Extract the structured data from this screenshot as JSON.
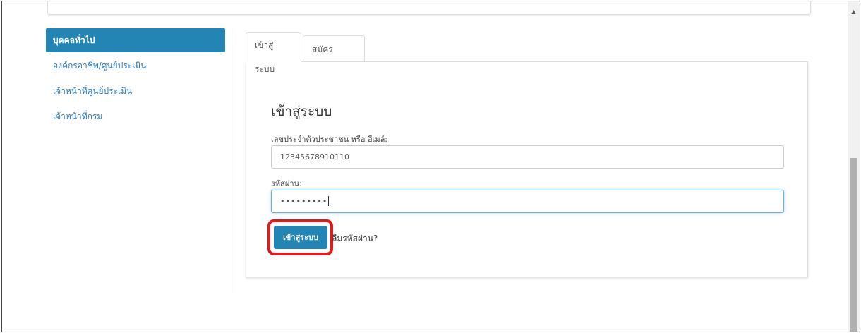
{
  "sidebar": {
    "items": [
      {
        "label": "บุคคลทั่วไป",
        "active": true
      },
      {
        "label": "องค์กรอาชีพ/ศูนย์ประเมิน",
        "active": false
      },
      {
        "label": "เจ้าหน้าที่ศูนย์ประเมิน",
        "active": false
      },
      {
        "label": "เจ้าหน้าที่กรม",
        "active": false
      }
    ]
  },
  "tabs": [
    {
      "label": "เข้าสู่ระบบ",
      "active": true
    },
    {
      "label": "สมัครสมาชิก",
      "active": false
    }
  ],
  "form": {
    "title": "เข้าสู่ระบบ",
    "id_label": "เลขประจำตัวประชาชน หรือ อีเมล์:",
    "id_value": "12345678910110",
    "password_label": "รหัสผ่าน:",
    "password_value": "•••••••••",
    "login_button": "เข้าสู่ระบบ",
    "forgot_link": "ลืมรหัสผ่าน?"
  },
  "colors": {
    "primary": "#2385b3",
    "link": "#2a7bc0",
    "highlight": "#e0191c"
  },
  "icons": {
    "scroll_up": "chevron-up-icon"
  }
}
